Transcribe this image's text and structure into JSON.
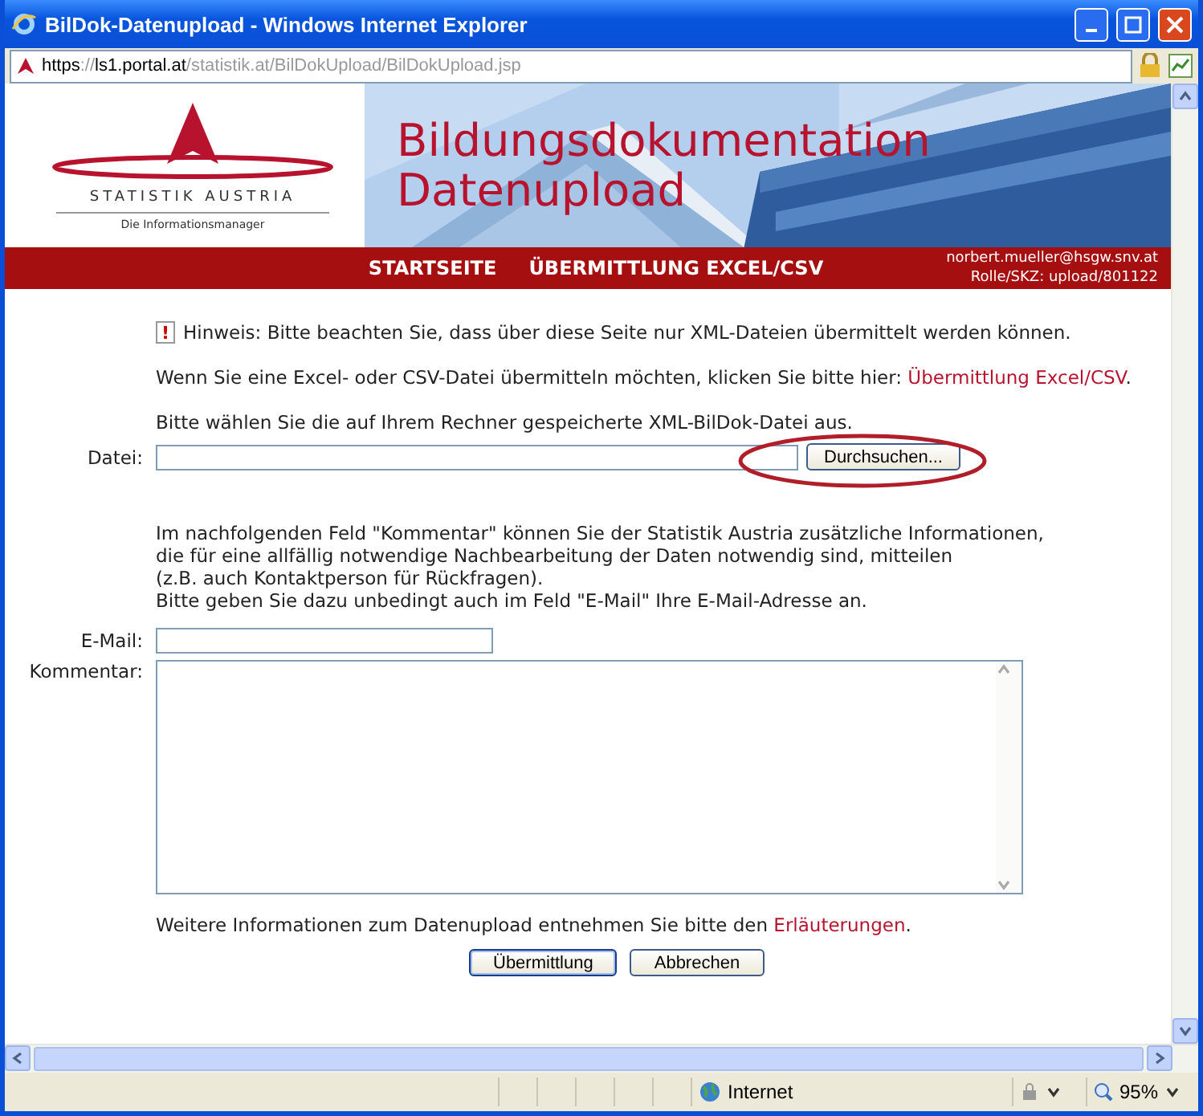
{
  "window": {
    "title": "BilDok-Datenupload - Windows Internet Explorer"
  },
  "address_bar": {
    "url_parts": [
      {
        "text": "https",
        "dim": false
      },
      {
        "text": "://",
        "dim": true
      },
      {
        "text": "ls1.portal.at",
        "dim": false
      },
      {
        "text": "/statistik.at/BilDokUpload/BilDokUpload.jsp",
        "dim": true
      }
    ]
  },
  "header": {
    "logo_name": "STATISTIK AUSTRIA",
    "logo_tagline": "Die Informationsmanager",
    "title_lines": [
      "Bildungsdokumentation",
      "Datenupload"
    ]
  },
  "nav": {
    "items": [
      "STARTSEITE",
      "ÜBERMITTLUNG EXCEL/CSV"
    ],
    "user_lines": [
      "norbert.mueller@hsgw.snv.at",
      "Rolle/SKZ: upload/801122"
    ]
  },
  "notice": {
    "icon": "!",
    "text": "Hinweis: Bitte beachten Sie, dass über diese Seite nur XML-Dateien übermittelt werden können."
  },
  "excel_hint": {
    "text": "Wenn Sie eine Excel- oder CSV-Datei übermitteln möchten, klicken Sie bitte hier: ",
    "link": "Übermittlung Excel/CSV",
    "after": "."
  },
  "file_prompt": "Bitte wählen Sie die auf Ihrem Rechner gespeicherte XML-BilDok-Datei aus.",
  "file_field": {
    "label": "Datei:",
    "button": "Durchsuchen...",
    "highlighted": true
  },
  "comment_info": [
    "Im nachfolgenden Feld \"Kommentar\" können Sie der Statistik Austria zusätzliche Informationen,",
    "die für eine allfällig notwendige Nachbearbeitung der Daten notwendig sind, mitteilen",
    "(z.B. auch Kontaktperson für Rückfragen).",
    "Bitte geben Sie dazu unbedingt auch im Feld \"E-Mail\" Ihre E-Mail-Adresse an."
  ],
  "email_field": {
    "label": "E-Mail:"
  },
  "comment_field": {
    "label": "Kommentar:"
  },
  "more_info": {
    "text": "Weitere Informationen zum Datenupload entnehmen Sie bitte den ",
    "link": "Erläuterungen",
    "after": "."
  },
  "buttons": [
    {
      "label": "Übermittlung",
      "default": true
    },
    {
      "label": "Abbrechen",
      "default": false
    }
  ],
  "status_bar": {
    "zone": "Internet",
    "zoom": "95%"
  }
}
